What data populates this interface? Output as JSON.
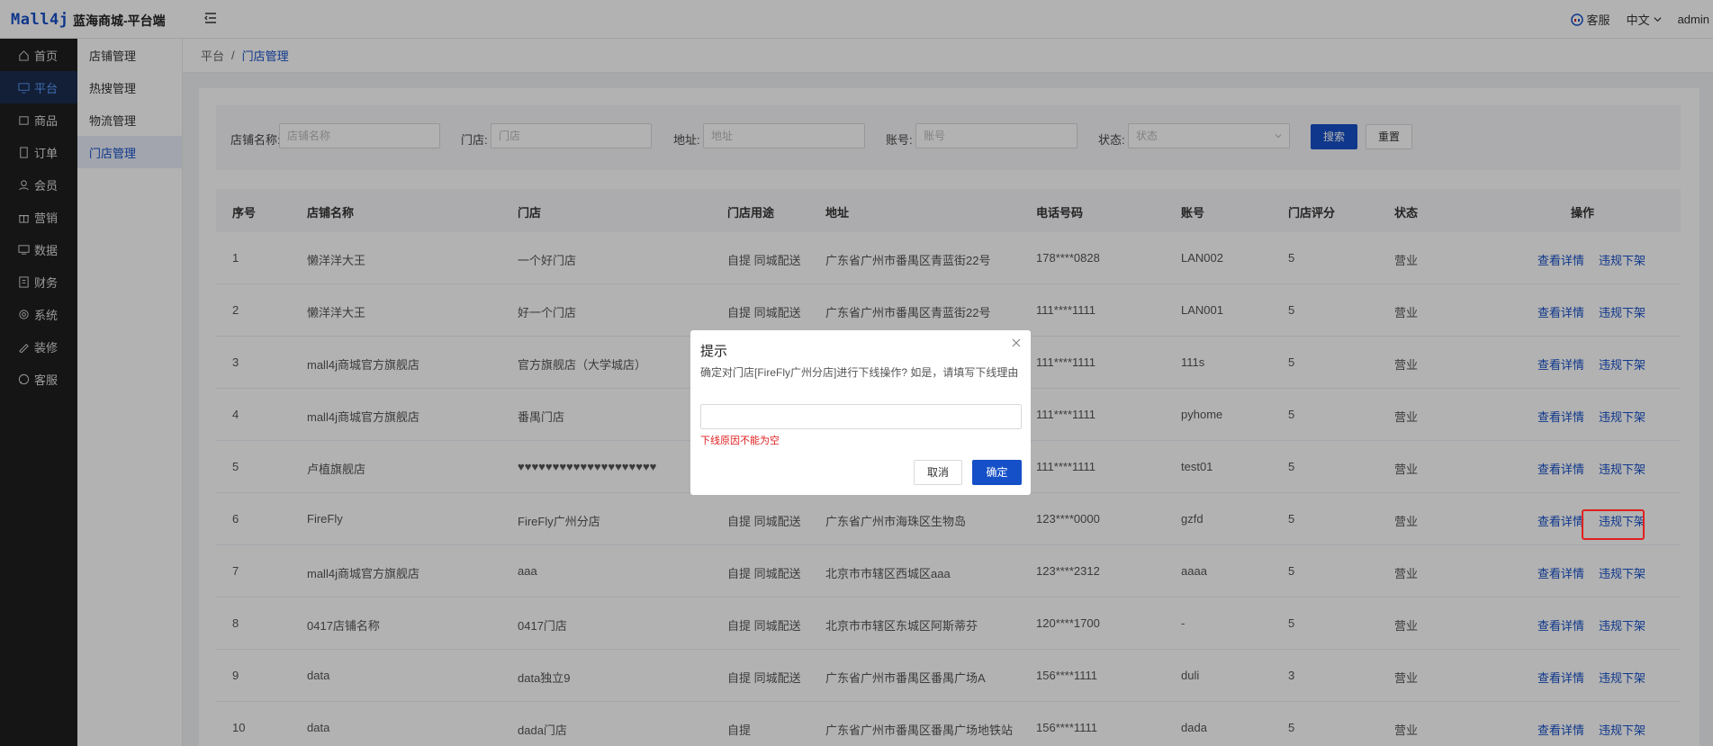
{
  "header": {
    "logo": "Mall4j",
    "title": "蓝海商城-平台端",
    "service": "客服",
    "language": "中文",
    "user": "admin"
  },
  "sidebar": [
    {
      "label": "首页",
      "icon": "home-icon"
    },
    {
      "label": "平台",
      "icon": "monitor-icon",
      "active": true
    },
    {
      "label": "商品",
      "icon": "goods-icon"
    },
    {
      "label": "订单",
      "icon": "order-icon"
    },
    {
      "label": "会员",
      "icon": "member-icon"
    },
    {
      "label": "营销",
      "icon": "gift-icon"
    },
    {
      "label": "数据",
      "icon": "data-icon"
    },
    {
      "label": "财务",
      "icon": "finance-icon"
    },
    {
      "label": "系统",
      "icon": "gear-icon"
    },
    {
      "label": "装修",
      "icon": "brush-icon"
    },
    {
      "label": "客服",
      "icon": "chat-icon"
    }
  ],
  "subnav": [
    {
      "label": "店铺管理"
    },
    {
      "label": "热搜管理"
    },
    {
      "label": "物流管理"
    },
    {
      "label": "门店管理",
      "active": true
    }
  ],
  "breadcrumb": {
    "root": "平台",
    "sep": "/",
    "current": "门店管理"
  },
  "filters": {
    "shop_label": "店铺名称:",
    "shop_placeholder": "店铺名称",
    "store_label": "门店:",
    "store_placeholder": "门店",
    "addr_label": "地址:",
    "addr_placeholder": "地址",
    "account_label": "账号:",
    "account_placeholder": "账号",
    "status_label": "状态:",
    "status_placeholder": "状态",
    "search": "搜索",
    "reset": "重置"
  },
  "table": {
    "headers": [
      "序号",
      "店铺名称",
      "门店",
      "门店用途",
      "地址",
      "电话号码",
      "账号",
      "门店评分",
      "状态",
      "操作"
    ],
    "rows": [
      [
        "1",
        "懒洋洋大王",
        "一个好门店",
        "自提 同城配送",
        "广东省广州市番禺区青蓝街22号",
        "178****0828",
        "LAN002",
        "5",
        "营业"
      ],
      [
        "2",
        "懒洋洋大王",
        "好一个门店",
        "自提 同城配送",
        "广东省广州市番禺区青蓝街22号",
        "111****1111",
        "LAN001",
        "5",
        "营业"
      ],
      [
        "3",
        "mall4j商城官方旗舰店",
        "官方旗舰店（大学城店）",
        "",
        "",
        "111****1111",
        "111s",
        "5",
        "营业"
      ],
      [
        "4",
        "mall4j商城官方旗舰店",
        "番禺门店",
        "",
        "",
        "111****1111",
        "pyhome",
        "5",
        "营业"
      ],
      [
        "5",
        "卢植旗舰店",
        "♥♥♥♥♥♥♥♥♥♥♥♥♥♥♥♥♥♥♥♥",
        "",
        "",
        "111****1111",
        "test01",
        "5",
        "营业"
      ],
      [
        "6",
        "FireFly",
        "FireFly广州分店",
        "自提 同城配送",
        "广东省广州市海珠区生物岛",
        "123****0000",
        "gzfd",
        "5",
        "营业"
      ],
      [
        "7",
        "mall4j商城官方旗舰店",
        "aaa",
        "自提 同城配送",
        "北京市市辖区西城区aaa",
        "123****2312",
        "aaaa",
        "5",
        "营业"
      ],
      [
        "8",
        "0417店铺名称",
        "0417门店",
        "自提 同城配送",
        "北京市市辖区东城区阿斯蒂芬",
        "120****1700",
        "-",
        "5",
        "营业"
      ],
      [
        "9",
        "data",
        "data独立9",
        "自提 同城配送",
        "广东省广州市番禺区番禺广场A",
        "156****1111",
        "duli",
        "3",
        "营业"
      ],
      [
        "10",
        "data",
        "dada门店",
        "自提",
        "广东省广州市番禺区番禺广场地铁站",
        "156****1111",
        "dada",
        "5",
        "营业"
      ]
    ],
    "action_view": "查看详情",
    "action_offline": "违规下架"
  },
  "dialog": {
    "title": "提示",
    "message": "确定对门店[FireFly广州分店]进行下线操作? 如是，请填写下线理由",
    "input_value": "",
    "error": "下线原因不能为空",
    "cancel": "取消",
    "confirm": "确定"
  },
  "colors": {
    "primary": "#1650c8",
    "error": "#e02020",
    "sidebar_bg": "#1f1f1f"
  }
}
